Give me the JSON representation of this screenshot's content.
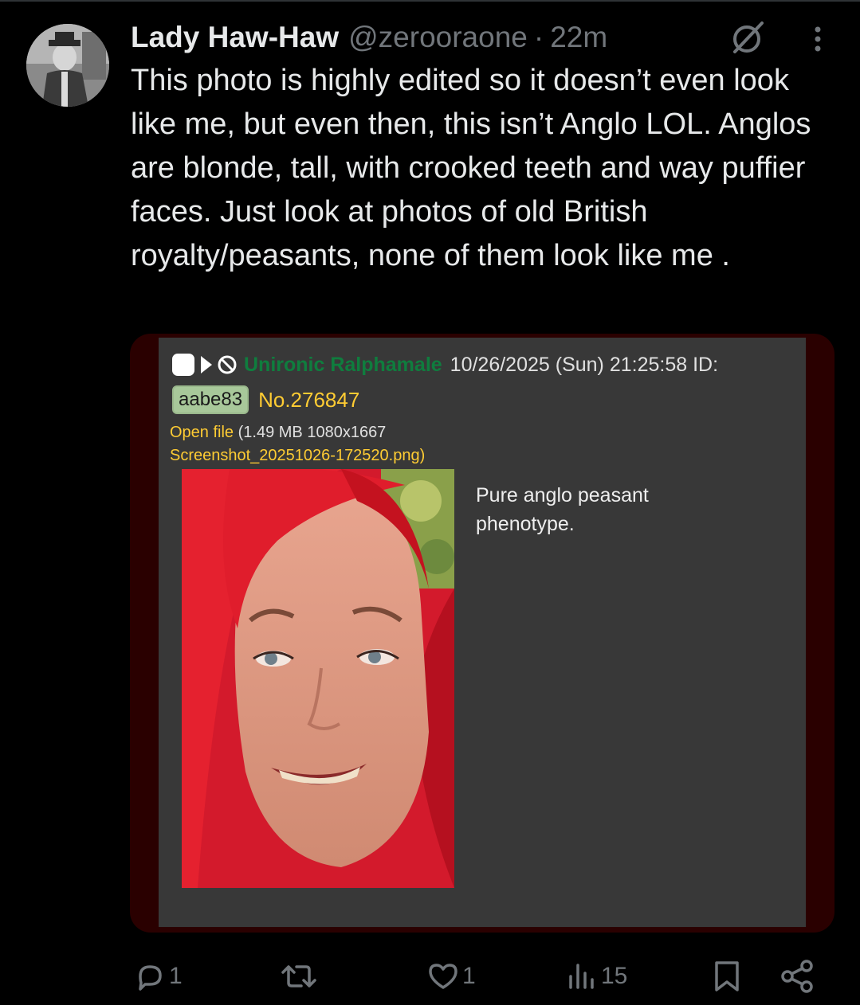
{
  "tweet": {
    "display_name": "Lady Haw-Haw",
    "handle": "@zerooraone",
    "separator": "·",
    "time": "22m",
    "text": "This photo is highly edited so it doesn’t even look like me, but even then, this isn’t Anglo LOL. Anglos are blonde, tall, with crooked teeth and way puffier faces. Just look at photos of old British royalty/peasants, none of them look like me ."
  },
  "embedded_post": {
    "poster_name": "Unironic Ralphamale",
    "meta": "10/26/2025 (Sun) 21:25:58 ID:",
    "id_badge": "aabe83",
    "post_number": "No.276847",
    "open_file_label": "Open file",
    "file_info": "(1.49 MB 1080x1667",
    "file_name": "Screenshot_20251026-172520.png)",
    "body": "Pure anglo peasant phenotype."
  },
  "actions": {
    "replies": "1",
    "likes": "1",
    "views": "15"
  },
  "colors": {
    "background": "#000000",
    "text": "#e7e9ea",
    "muted": "#71767b",
    "card_border": "#2a0000",
    "panel": "#383838",
    "poster_name": "#0f7d3e",
    "link_yellow": "#ffcc33",
    "hair_red": "#d8182e"
  },
  "icons": [
    "grok-icon",
    "more-icon",
    "reply-icon",
    "repost-icon",
    "like-icon",
    "views-icon",
    "bookmark-icon",
    "share-icon",
    "play-icon",
    "ban-icon"
  ]
}
